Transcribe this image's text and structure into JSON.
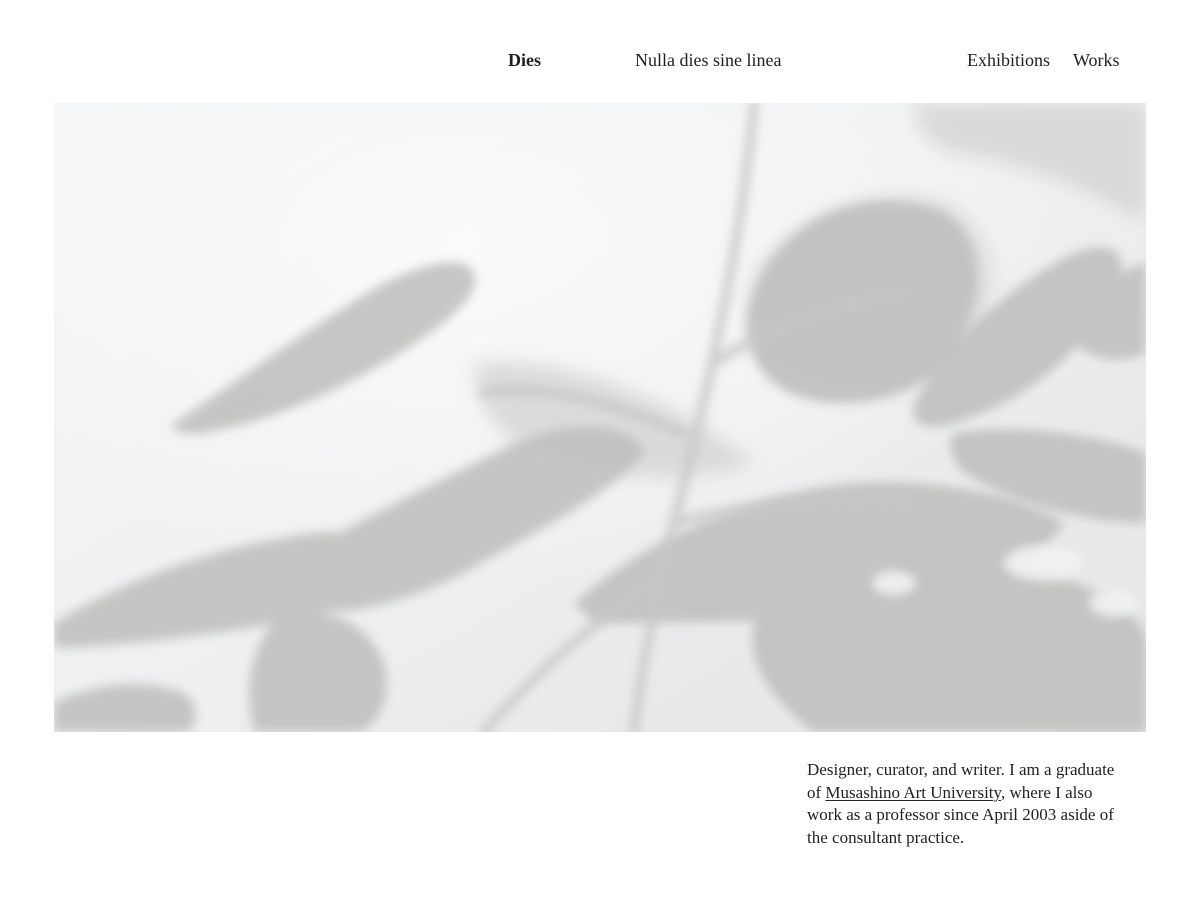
{
  "header": {
    "brand": "Dies",
    "tagline": "Nulla dies sine linea",
    "nav": [
      {
        "label": "Exhibitions"
      },
      {
        "label": "Works"
      }
    ]
  },
  "hero": {
    "icon": "plant-shadow-photo"
  },
  "bio": {
    "text_before": "Designer, curator, and writer. I am a graduate of ",
    "link_label": "Musashino Art University",
    "text_after": ", where I also work as a professor since April 2003 aside of the consultant practice."
  }
}
